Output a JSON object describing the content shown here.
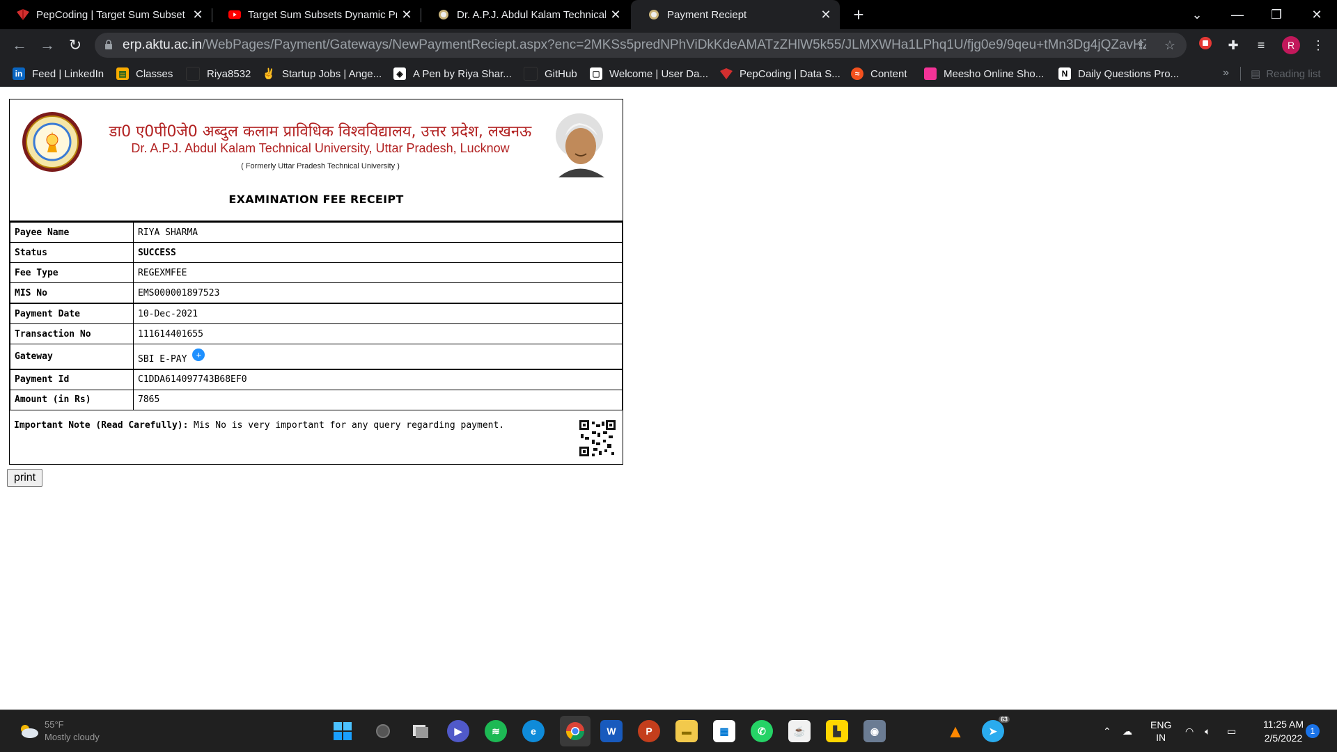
{
  "browser": {
    "tabs": [
      {
        "title": "PepCoding | Target Sum Subsets",
        "favicon": "pepcoding-icon"
      },
      {
        "title": "Target Sum Subsets Dynamic Pro",
        "favicon": "youtube-icon"
      },
      {
        "title": "Dr. A.P.J. Abdul Kalam Technical U",
        "favicon": "aktu-icon"
      },
      {
        "title": "Payment Reciept",
        "favicon": "aktu-icon"
      }
    ],
    "active_tab": 3,
    "url_host": "erp.aktu.ac.in",
    "url_rest": "/WebPages/Payment/Gateways/NewPaymentReciept.aspx?enc=2MKSs5predNPhViDkKdeAMATzZHlW5k55/JLMXWHa1LPhq1U/fjg0e9/9qeu+tMn3Dg4jQZavHZWqaEADQkV...",
    "profile_initial": "R",
    "bookmarks": [
      {
        "label": "Feed | LinkedIn",
        "icon": "linkedin-icon"
      },
      {
        "label": "Classes",
        "icon": "classroom-icon"
      },
      {
        "label": "Riya8532",
        "icon": "github-icon"
      },
      {
        "label": "Startup Jobs | Ange...",
        "icon": "angellist-icon"
      },
      {
        "label": "A Pen by Riya Shar...",
        "icon": "codepen-icon"
      },
      {
        "label": "GitHub",
        "icon": "github-icon"
      },
      {
        "label": "Welcome | User Da...",
        "icon": "page-icon"
      },
      {
        "label": "PepCoding | Data S...",
        "icon": "pepcoding-icon"
      },
      {
        "label": "Content",
        "icon": "content-icon"
      },
      {
        "label": "Meesho Online Sho...",
        "icon": "meesho-icon"
      },
      {
        "label": "Daily Questions Pro...",
        "icon": "notion-icon"
      }
    ],
    "reading_list": "Reading list"
  },
  "receipt": {
    "university_hindi": "डा0 ए0पी0जे0 अब्दुल कलाम प्राविधिक विश्वविद्यालय, उत्तर प्रदेश, लखनऊ",
    "university_english": "Dr. A.P.J. Abdul Kalam Technical University, Uttar Pradesh, Lucknow",
    "formerly": "( Formerly Uttar Pradesh Technical University )",
    "title": "EXAMINATION FEE RECEIPT",
    "rows": [
      {
        "label": "Payee Name",
        "value": "RIYA SHARMA"
      },
      {
        "label": "Status",
        "value": "SUCCESS"
      },
      {
        "label": "Fee Type",
        "value": "REGEXMFEE"
      },
      {
        "label": "MIS No",
        "value": "EMS000001897523"
      },
      {
        "label": "Payment Date",
        "value": "10-Dec-2021"
      },
      {
        "label": "Transaction No",
        "value": "111614401655"
      },
      {
        "label": "Gateway",
        "value": "SBI E-PAY"
      },
      {
        "label": "Payment Id",
        "value": "C1DDA614097743B68EF0"
      },
      {
        "label": "Amount (in Rs)",
        "value": "7865"
      }
    ],
    "note_label": "Important Note (Read Carefully):",
    "note_text": "Mis No is very important for any query regarding payment.",
    "print_label": "print"
  },
  "taskbar": {
    "weather_temp": "55°F",
    "weather_desc": "Mostly cloudy",
    "lang_top": "ENG",
    "lang_bottom": "IN",
    "time": "11:25 AM",
    "date": "2/5/2022",
    "notifications": "1",
    "telegram_badge": "63"
  }
}
